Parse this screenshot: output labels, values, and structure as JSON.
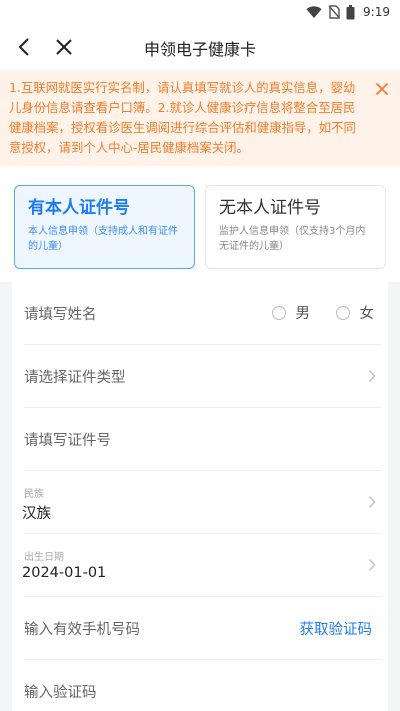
{
  "status_bar": {
    "time": "9:19"
  },
  "nav": {
    "title": "申领电子健康卡"
  },
  "notice": {
    "text": "1.互联网就医实行实名制，请认真填写就诊人的真实信息，婴幼儿身份信息请查看户口簿。2.就诊人健康诊疗信息将整合至居民健康档案，授权看诊医生调阅进行综合评估和健康指导，如不同意授权，请到个人中心-居民健康档案关闭。",
    "accent_color": "#f37c2d"
  },
  "cards": [
    {
      "title": "有本人证件号",
      "desc": "本人信息申领（支持成人和有证件的儿童）",
      "selected": true
    },
    {
      "title": "无本人证件号",
      "desc": "监护人信息申领（仅支持3个月内无证件的儿童）",
      "selected": false
    }
  ],
  "form": {
    "name_placeholder": "请填写姓名",
    "gender": {
      "male": "男",
      "female": "女"
    },
    "id_type_placeholder": "请选择证件类型",
    "id_number_placeholder": "请填写证件号",
    "ethnicity": {
      "label": "民族",
      "value": "汉族"
    },
    "birth": {
      "label": "出生日期",
      "value": "2024-01-01"
    },
    "phone_placeholder": "输入有效手机号码",
    "get_code": "获取验证码",
    "code_placeholder": "输入验证码"
  },
  "colors": {
    "primary": "#1f7cf0",
    "notice_bg": "#fff3e9"
  }
}
